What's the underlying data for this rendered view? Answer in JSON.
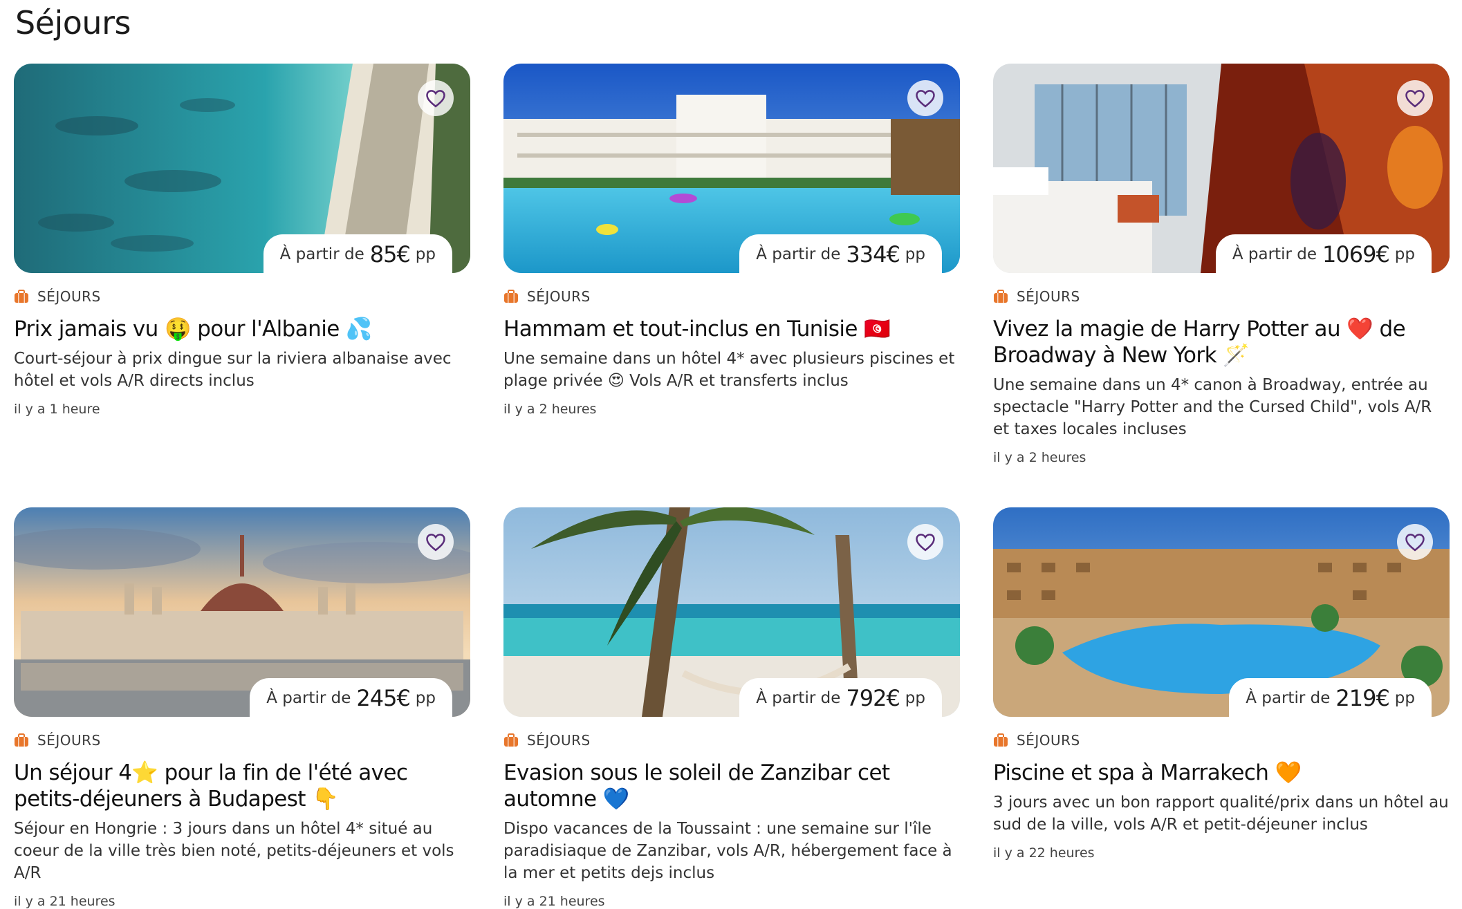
{
  "page": {
    "title": "Séjours"
  },
  "colors": {
    "accent": "#e8762b",
    "heart": "#5a2d7a",
    "text": "#111111"
  },
  "cards": [
    {
      "category": "SÉJOURS",
      "price_prefix": "À partir de",
      "price": "85€",
      "price_suffix": "pp",
      "title": "Prix jamais vu 🤑 pour l'Albanie 💦",
      "description": "Court-séjour à prix dingue sur la riviera albanaise avec hôtel et vols A/R directs inclus",
      "time": "il y a 1 heure",
      "image": "albania-beach-aerial"
    },
    {
      "category": "SÉJOURS",
      "price_prefix": "À partir de",
      "price": "334€",
      "price_suffix": "pp",
      "title": "Hammam et tout-inclus en Tunisie 🇹🇳",
      "description": "Une semaine dans un hôtel 4* avec plusieurs piscines et plage privée 😍 Vols A/R et transferts inclus",
      "time": "il y a 2 heures",
      "image": "tunisia-hotel-pool"
    },
    {
      "category": "SÉJOURS",
      "price_prefix": "À partir de",
      "price": "1069€",
      "price_suffix": "pp",
      "title": "Vivez la magie de Harry Potter au ❤️ de Broadway à New York 🪄",
      "description": "Une semaine dans un 4* canon à Broadway, entrée au spectacle \"Harry Potter and the Cursed Child\", vols A/R et taxes locales incluses",
      "time": "il y a 2 heures",
      "image": "new-york-hotel-room-and-show"
    },
    {
      "category": "SÉJOURS",
      "price_prefix": "À partir de",
      "price": "245€",
      "price_suffix": "pp",
      "title": "Un séjour 4⭐️ pour la fin de l'été avec petits-déjeuners à Budapest 👇",
      "description": "Séjour en Hongrie : 3 jours dans un hôtel 4* situé au coeur de la ville très bien noté, petits-déjeuners et vols A/R",
      "time": "il y a 21 heures",
      "image": "budapest-parliament"
    },
    {
      "category": "SÉJOURS",
      "price_prefix": "À partir de",
      "price": "792€",
      "price_suffix": "pp",
      "title": "Evasion sous le soleil de Zanzibar cet automne 💙",
      "description": "Dispo vacances de la Toussaint : une semaine sur l'île paradisiaque de Zanzibar, vols A/R, hébergement face à la mer et petits dejs inclus",
      "time": "il y a 21 heures",
      "image": "zanzibar-beach-hammock"
    },
    {
      "category": "SÉJOURS",
      "price_prefix": "À partir de",
      "price": "219€",
      "price_suffix": "pp",
      "title": "Piscine et spa à Marrakech 🧡",
      "description": "3 jours avec un bon rapport qualité/prix dans un hôtel au sud de la ville, vols A/R et petit-déjeuner inclus",
      "time": "il y a 22 heures",
      "image": "marrakech-resort-pool"
    }
  ]
}
